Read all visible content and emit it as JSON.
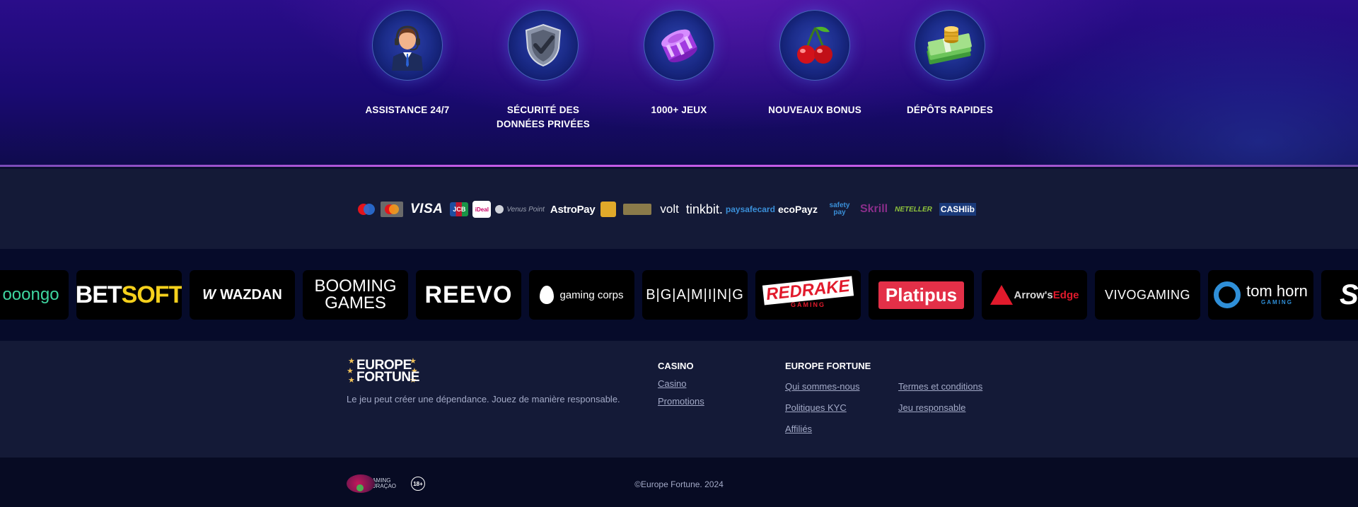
{
  "features": [
    {
      "label": "ASSISTANCE 24/7",
      "icon": "support-agent-icon"
    },
    {
      "label": "SÉCURITÉ DES DONNÉES PRIVÉES",
      "icon": "shield-check-icon"
    },
    {
      "label": "1000+ JEUX",
      "icon": "casino-chips-icon"
    },
    {
      "label": "NOUVEAUX BONUS",
      "icon": "cherries-icon"
    },
    {
      "label": "DÉPÔTS RAPIDES",
      "icon": "money-coins-icon"
    }
  ],
  "payments": {
    "visa": "VISA",
    "jcb": "JCB",
    "ideal": "iDeal",
    "venus_point": "Venus Point",
    "astropay": "AstroPay",
    "volt": "volt",
    "tinkbit": "tinkbit.",
    "paysafecard": "paysafecard",
    "ecopayz": "ecoPayz",
    "safety_pay": "safety pay",
    "skrill": "Skrill",
    "neteller": "NETELLER",
    "cashlib": "CASHlib"
  },
  "providers": [
    {
      "name": "booongo",
      "display": "ooongo",
      "color": "#3ed6a0"
    },
    {
      "name": "betsoft",
      "display_a": "BET",
      "display_b": "SOFT"
    },
    {
      "name": "wazdan",
      "display": "WAZDAN"
    },
    {
      "name": "booming-games",
      "display_a": "BOOMING",
      "display_b": "GAMES"
    },
    {
      "name": "reevo",
      "display": "REEVO"
    },
    {
      "name": "gaming-corps",
      "display": "gaming corps"
    },
    {
      "name": "bgaming",
      "display": "B|G|A|M|I|N|G"
    },
    {
      "name": "red-rake",
      "display_a": "REDRAKE",
      "display_b": "GAMING"
    },
    {
      "name": "platipus",
      "display": "Platipus"
    },
    {
      "name": "arrows-edge",
      "display_a": "Arrow's",
      "display_b": "Edge"
    },
    {
      "name": "vivo-gaming",
      "display": "VIVOGAMING"
    },
    {
      "name": "tom-horn",
      "display_a": "tom horn",
      "display_b": "GAMING"
    },
    {
      "name": "spinomenal",
      "display": "SP"
    }
  ],
  "footer": {
    "logo_line1": "EUROPE",
    "logo_line2": "FORTUNE",
    "tagline": "Le jeu peut créer une dépendance. Jouez de manière responsable.",
    "casino_title": "CASINO",
    "casino_links": [
      "Casino",
      "Promotions"
    ],
    "ef_title": "EUROPE FORTUNE",
    "ef_links_left": [
      "Qui sommes-nous",
      "Politiques KYC",
      "Affiliés"
    ],
    "ef_links_right": [
      "Termes et conditions",
      "Jeu responsable"
    ]
  },
  "bottom": {
    "license_text_1": "GAMING",
    "license_text_2": "CURAÇAO",
    "age_badge": "18+",
    "copyright": "©Europe Fortune. 2024"
  }
}
